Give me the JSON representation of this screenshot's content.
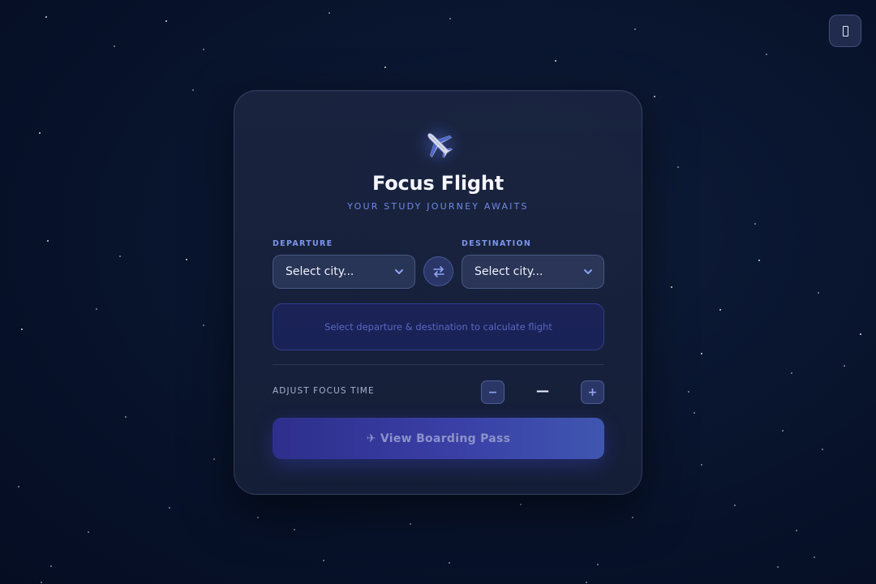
{
  "app": {
    "title": "Focus Flight",
    "subtitle": "YOUR STUDY JOURNEY AWAITS",
    "icon": "airplane-icon"
  },
  "top_right_button": {
    "icon": "unknown-glyph-icon"
  },
  "departure": {
    "label": "DEPARTURE",
    "value": "Select city..."
  },
  "destination": {
    "label": "DESTINATION",
    "value": "Select city..."
  },
  "swap_button": {
    "icon": "swap-arrows-icon"
  },
  "info": {
    "text": "Select departure & destination to calculate flight"
  },
  "focus_time": {
    "label": "ADJUST FOCUS TIME",
    "decrement_label": "−",
    "increment_label": "+",
    "value": "—"
  },
  "cta": {
    "label": "✈ View Boarding Pass"
  },
  "colors": {
    "accent": "#7c95ec",
    "background": "#061027",
    "card": "#1b2540",
    "cta_start": "#2e2f8c",
    "cta_end": "#3f56b0"
  }
}
